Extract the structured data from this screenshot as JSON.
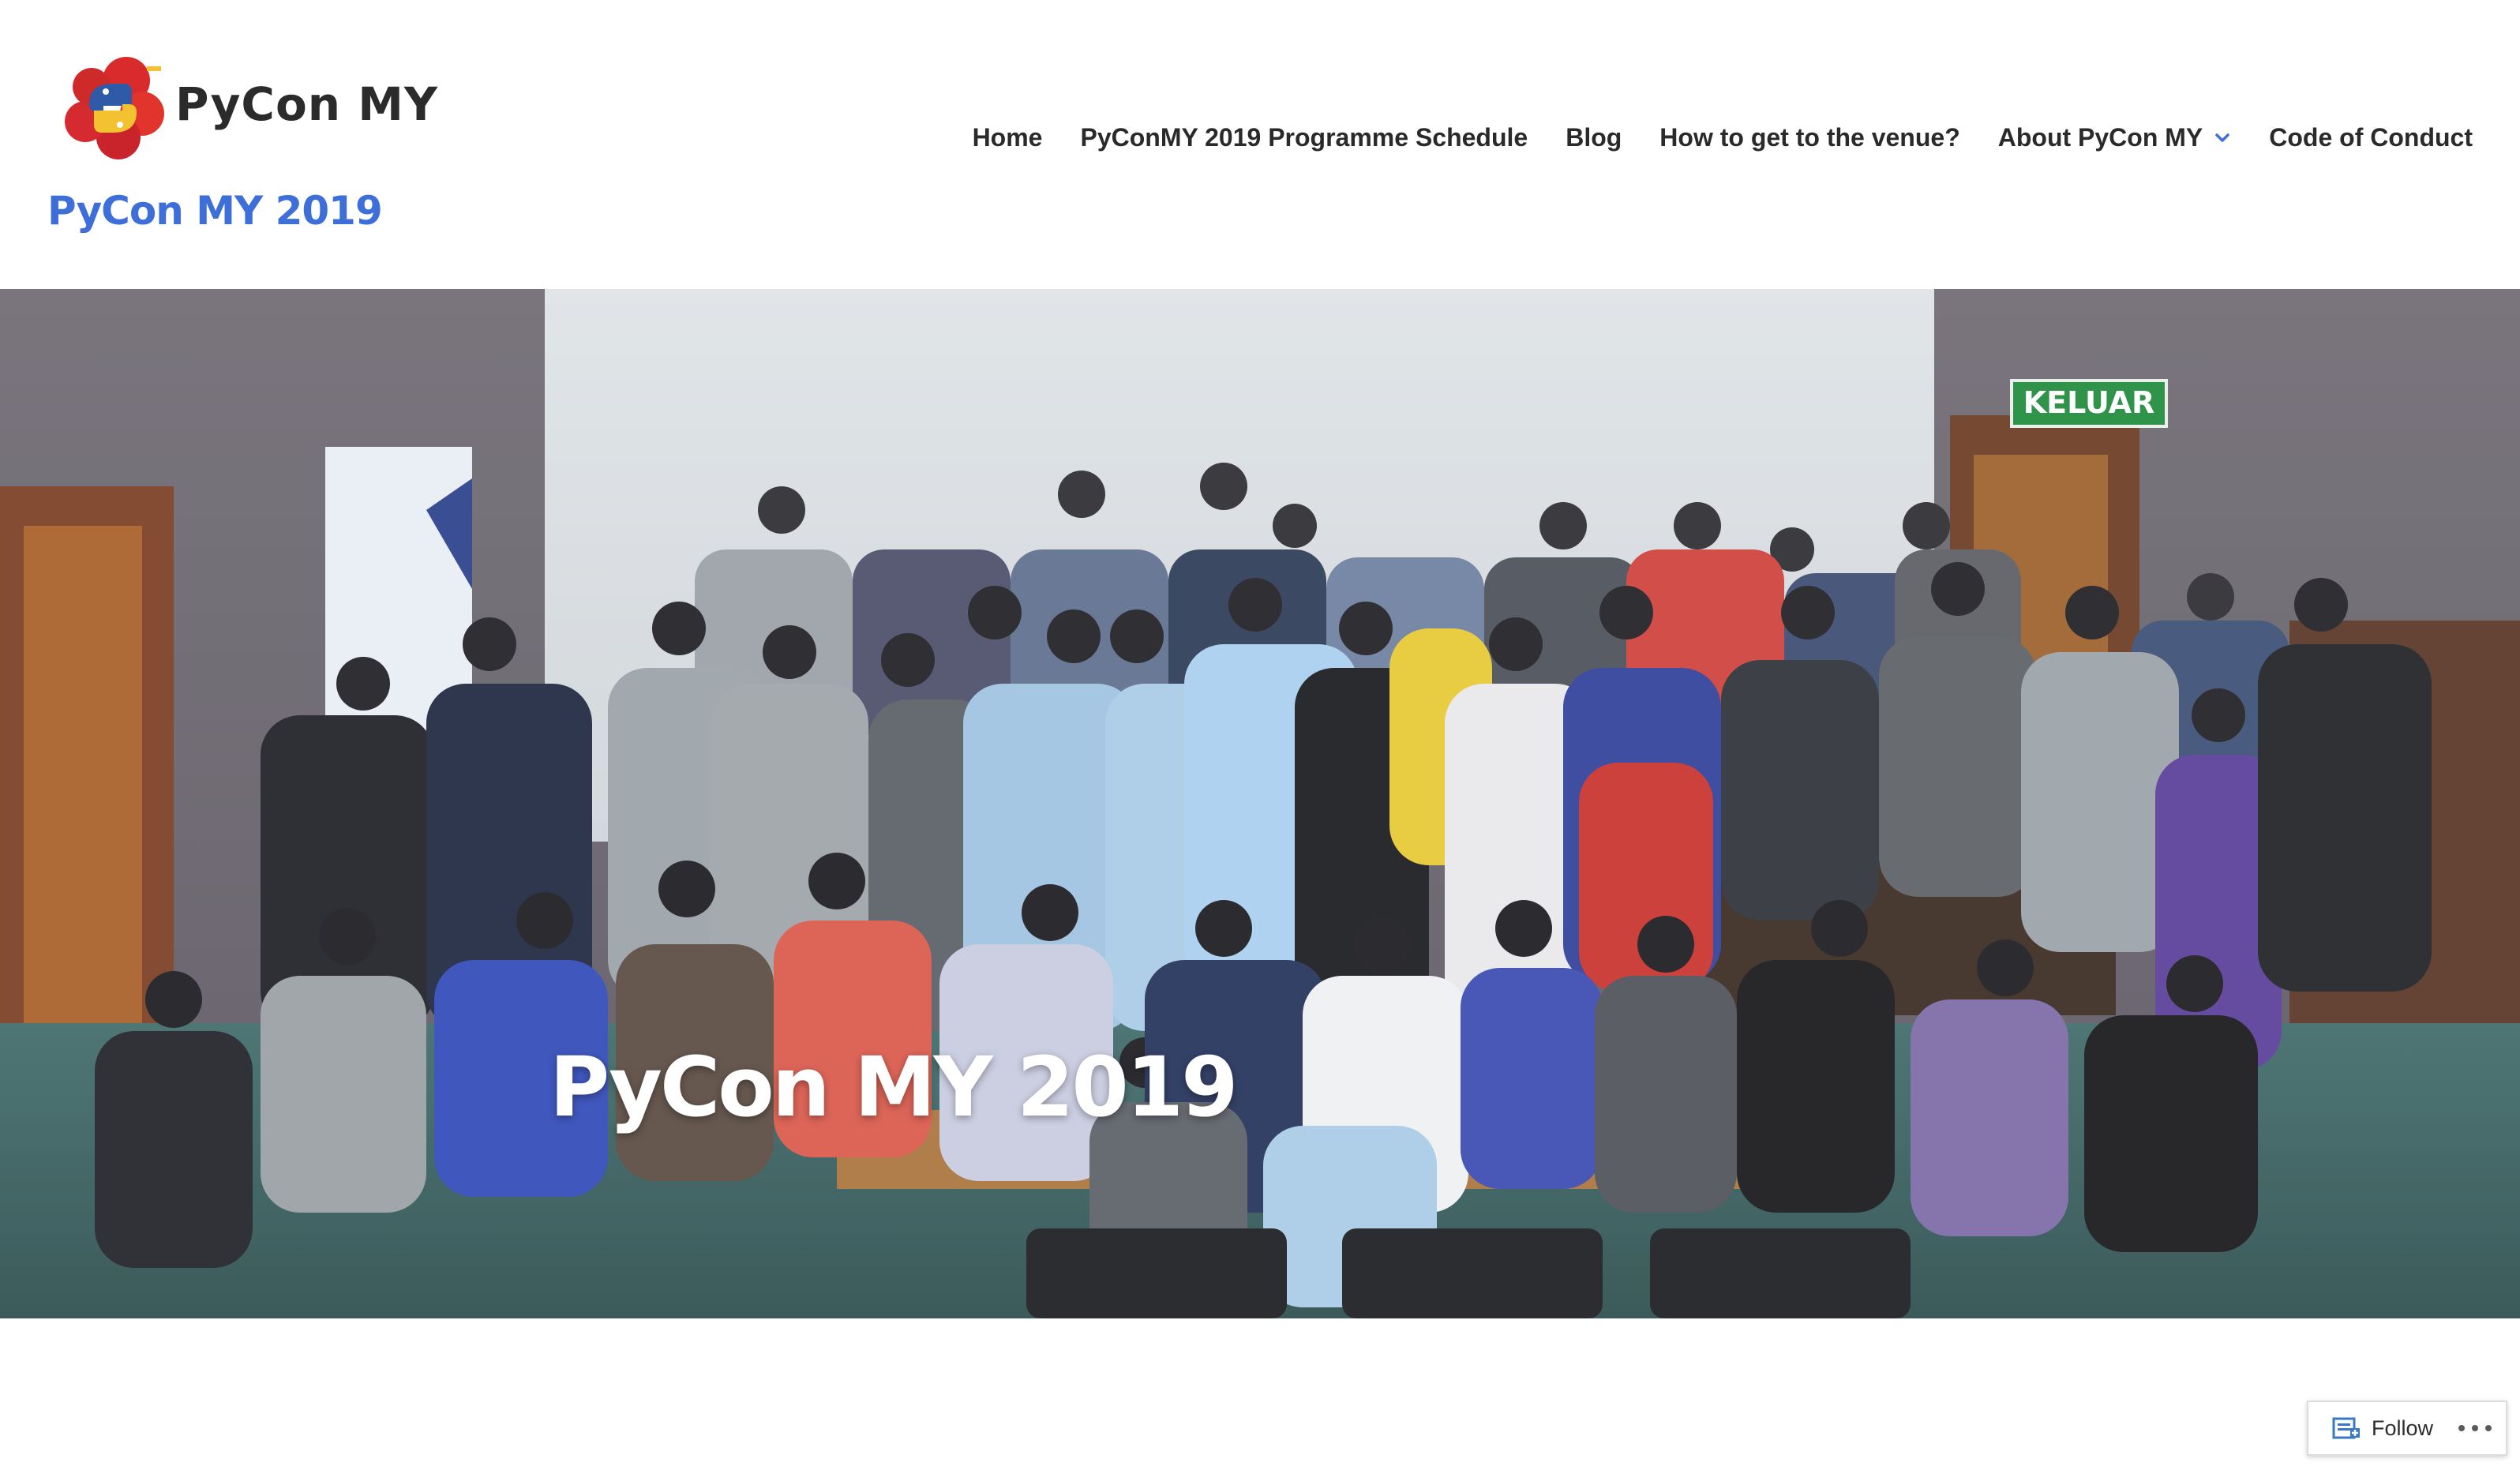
{
  "header": {
    "logo_text": "PyCon MY",
    "site_title": "PyCon MY 2019",
    "nav": [
      {
        "label": "Home"
      },
      {
        "label": "PyConMY 2019 Programme Schedule"
      },
      {
        "label": "Blog"
      },
      {
        "label": "How to get to the venue?"
      },
      {
        "label": "About PyCon MY",
        "has_dropdown": true
      },
      {
        "label": "Code of Conduct"
      }
    ]
  },
  "hero": {
    "title": "PyCon MY 2019",
    "sign_text": "KELUAR"
  },
  "follow": {
    "label": "Follow",
    "more_icon": "ellipsis-icon"
  },
  "colors": {
    "site_title": "#3e6fd9",
    "nav_text": "#2a2a2a",
    "hero_title": "#ffffff",
    "sign_green": "#1e8a3a"
  }
}
